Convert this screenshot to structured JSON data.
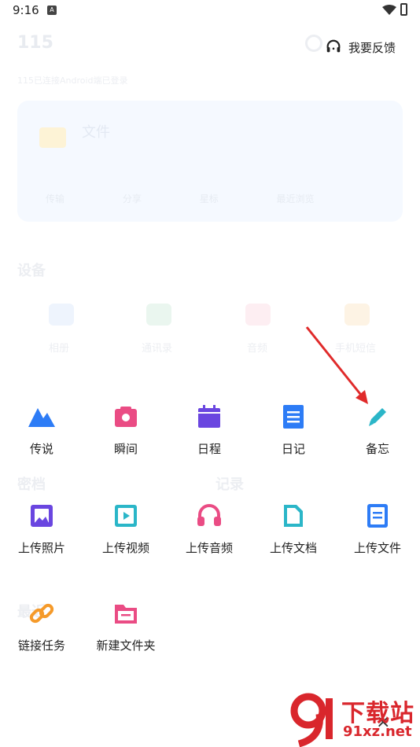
{
  "status": {
    "time": "9:16"
  },
  "header": {
    "app_title": "115",
    "feedback_label": "我要反馈"
  },
  "background": {
    "subtitle": "115已连接Android端已登录",
    "card_title": "文件",
    "card_actions": [
      "传输",
      "分享",
      "星标",
      "最近浏览"
    ],
    "section_devices": "设备",
    "section_vault": "密档",
    "section_records": "记录",
    "section_recent": "最近",
    "device_labels": [
      "相册",
      "通讯录",
      "音频",
      "手机短信"
    ]
  },
  "menu": {
    "row1": [
      {
        "label": "传说",
        "icon": "mountain-icon"
      },
      {
        "label": "瞬间",
        "icon": "camera-icon"
      },
      {
        "label": "日程",
        "icon": "calendar-icon"
      },
      {
        "label": "日记",
        "icon": "diary-icon"
      },
      {
        "label": "备忘",
        "icon": "pencil-icon"
      }
    ],
    "row2": [
      {
        "label": "上传照片",
        "icon": "upload-photo-icon"
      },
      {
        "label": "上传视频",
        "icon": "upload-video-icon"
      },
      {
        "label": "上传音频",
        "icon": "headphones-icon"
      },
      {
        "label": "上传文档",
        "icon": "document-icon"
      },
      {
        "label": "上传文件",
        "icon": "file-icon"
      }
    ],
    "row3": [
      {
        "label": "链接任务",
        "icon": "link-icon"
      },
      {
        "label": "新建文件夹",
        "icon": "new-folder-icon"
      }
    ]
  },
  "colors": {
    "blue": "#2d7cf6",
    "pink": "#ea4c84",
    "purple": "#6a46e0",
    "teal": "#2bb6c8",
    "orange": "#f59a2a",
    "annotation_red": "#e02a2a"
  },
  "watermark": {
    "big": "下载站",
    "small": "91xz.net"
  },
  "close_symbol": "×"
}
